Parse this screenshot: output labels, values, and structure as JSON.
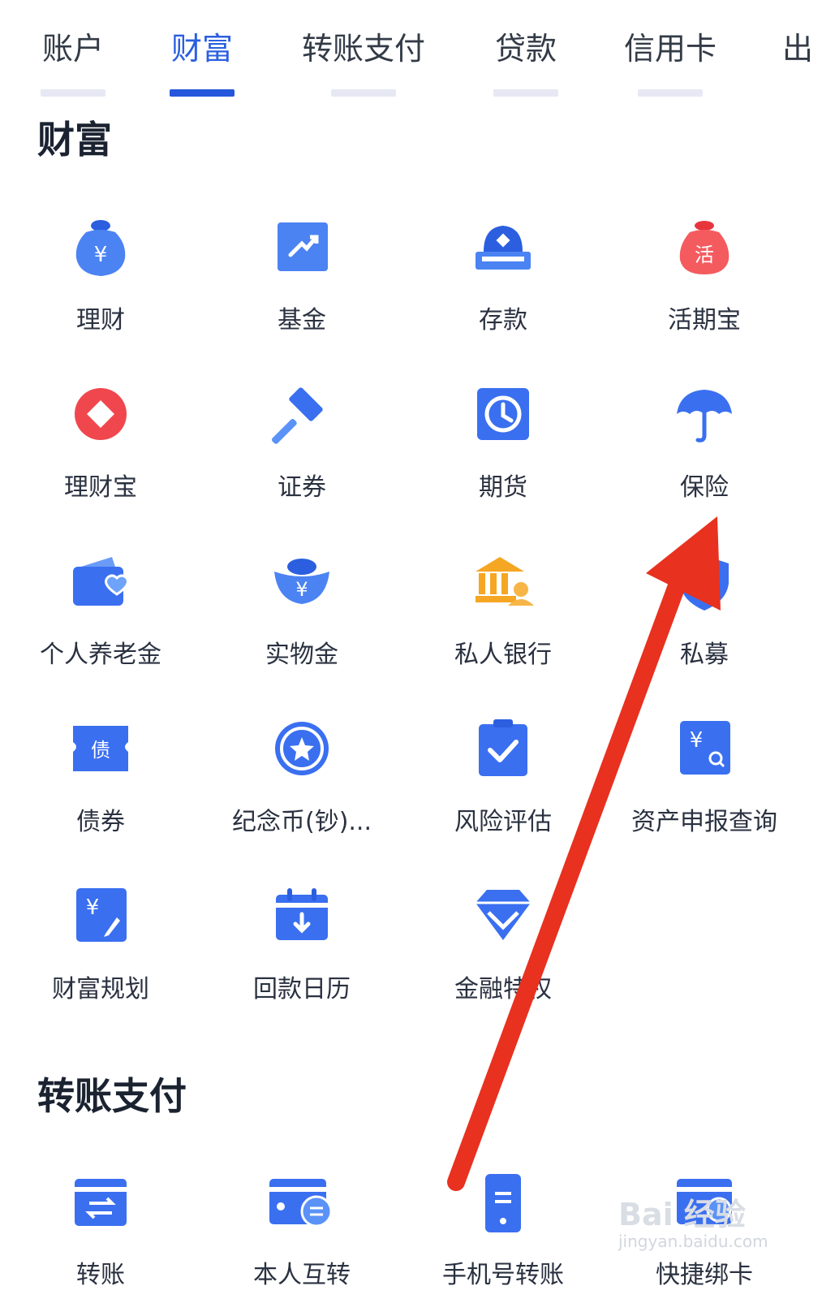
{
  "tabs": [
    {
      "label": "账户"
    },
    {
      "label": "财富",
      "active": true
    },
    {
      "label": "转账支付"
    },
    {
      "label": "贷款"
    },
    {
      "label": "信用卡"
    },
    {
      "label": "出"
    }
  ],
  "sections": {
    "wealth": {
      "title": "财富",
      "items": [
        {
          "label": "理财",
          "icon": "money-bag-yuan-icon"
        },
        {
          "label": "基金",
          "icon": "fund-chart-icon"
        },
        {
          "label": "存款",
          "icon": "deposit-icon"
        },
        {
          "label": "活期宝",
          "icon": "huoqi-bag-icon"
        },
        {
          "label": "理财宝",
          "icon": "coin-icon"
        },
        {
          "label": "证券",
          "icon": "gavel-icon"
        },
        {
          "label": "期货",
          "icon": "clock-icon"
        },
        {
          "label": "保险",
          "icon": "umbrella-icon"
        },
        {
          "label": "个人养老金",
          "icon": "wallet-heart-icon"
        },
        {
          "label": "实物金",
          "icon": "gold-ingot-icon"
        },
        {
          "label": "私人银行",
          "icon": "bank-person-icon"
        },
        {
          "label": "私募",
          "icon": "shield-icon"
        },
        {
          "label": "债券",
          "icon": "bond-ticket-icon"
        },
        {
          "label": "纪念币(钞)...",
          "icon": "star-coin-icon"
        },
        {
          "label": "风险评估",
          "icon": "clipboard-check-icon"
        },
        {
          "label": "资产申报查询",
          "icon": "yuan-search-icon"
        },
        {
          "label": "财富规划",
          "icon": "yuan-pen-icon"
        },
        {
          "label": "回款日历",
          "icon": "calendar-icon"
        },
        {
          "label": "金融特权",
          "icon": "diamond-icon"
        }
      ]
    },
    "transfer": {
      "title": "转账支付",
      "items": [
        {
          "label": "转账",
          "icon": "transfer-card-icon"
        },
        {
          "label": "本人互转",
          "icon": "self-transfer-icon"
        },
        {
          "label": "手机号转账",
          "icon": "phone-transfer-icon"
        },
        {
          "label": "快捷绑卡",
          "icon": "bind-card-icon"
        }
      ]
    }
  },
  "colors": {
    "primary": "#2b5fe0",
    "blue_light": "#5a92f7",
    "red": "#f0474e",
    "gold": "#f5a623",
    "arrow_red": "#e8311f"
  },
  "watermark": {
    "brand": "Bai 经验",
    "url": "jingyan.baidu.com"
  }
}
